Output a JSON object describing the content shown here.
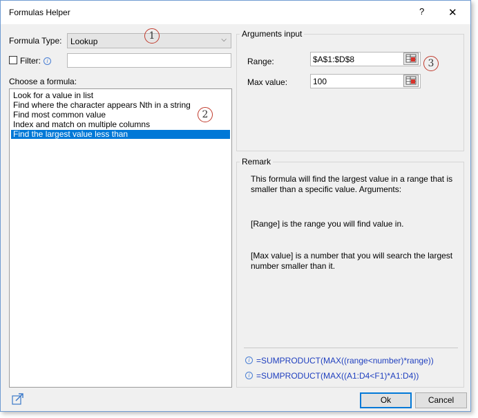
{
  "window": {
    "title": "Formulas Helper",
    "help": "?",
    "close": "✕"
  },
  "left": {
    "formula_type_label": "Formula Type:",
    "formula_type_value": "Lookup",
    "filter_label": "Filter:",
    "filter_value": "",
    "choose_label": "Choose a formula:",
    "formulas": [
      "Look for a value in list",
      "Find where the character appears Nth in a string",
      "Find most common value",
      "Index and match on multiple columns",
      "Find the largest value less than"
    ],
    "selected_formula_index": 4
  },
  "arguments": {
    "group_title": "Arguments input",
    "range_label": "Range:",
    "range_value": "$A$1:$D$8",
    "max_label": "Max value:",
    "max_value": "100"
  },
  "remark": {
    "group_title": "Remark",
    "description": "This formula will find the largest value in a range that is smaller than a specific value. Arguments:",
    "range_desc": "[Range] is the range you will find value in.",
    "max_desc": "[Max value] is a number that you will search the largest number smaller than it.",
    "formula_generic": "=SUMPRODUCT(MAX((range<number)*range))",
    "formula_applied": "=SUMPRODUCT(MAX((A1:D4<F1)*A1:D4))"
  },
  "buttons": {
    "ok": "Ok",
    "cancel": "Cancel"
  },
  "callouts": [
    "1",
    "2",
    "3"
  ],
  "colors": {
    "selection": "#0078d7",
    "formula_text": "#1f3fbf",
    "callout_ring": "#c0392b"
  }
}
